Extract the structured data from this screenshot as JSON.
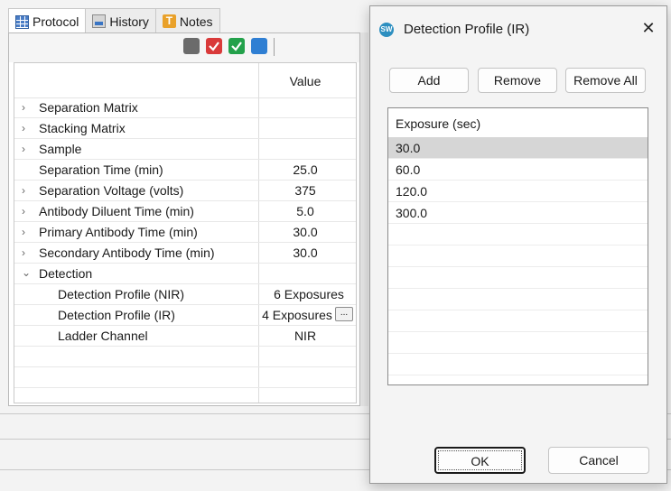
{
  "tabs": [
    {
      "label": "Protocol",
      "icon": "protocol-grid-icon"
    },
    {
      "label": "History",
      "icon": "history-icon"
    },
    {
      "label": "Notes",
      "icon": "notes-icon"
    }
  ],
  "grid": {
    "value_header": "Value",
    "rows": [
      {
        "name": "Separation Matrix",
        "value": ""
      },
      {
        "name": "Stacking Matrix",
        "value": ""
      },
      {
        "name": "Sample",
        "value": ""
      },
      {
        "name": "Separation Time (min)",
        "value": "25.0"
      },
      {
        "name": "Separation Voltage (volts)",
        "value": "375"
      },
      {
        "name": "Antibody Diluent Time (min)",
        "value": "5.0"
      },
      {
        "name": "Primary Antibody Time (min)",
        "value": "30.0"
      },
      {
        "name": "Secondary Antibody Time (min)",
        "value": "30.0"
      },
      {
        "name": "Detection",
        "value": ""
      },
      {
        "name": "Detection Profile (NIR)",
        "value": "6 Exposures"
      },
      {
        "name": "Detection Profile (IR)",
        "value": "4 Exposures",
        "button": "..."
      },
      {
        "name": "Ladder Channel",
        "value": "NIR"
      }
    ]
  },
  "dialog": {
    "title": "Detection Profile (IR)",
    "app_icon_text": "SW",
    "close": "✕",
    "buttons": {
      "add": "Add",
      "remove": "Remove",
      "remove_all": "Remove All",
      "ok": "OK",
      "cancel": "Cancel"
    },
    "list": {
      "header": "Exposure (sec)",
      "items": [
        "30.0",
        "60.0",
        "120.0",
        "300.0"
      ],
      "selected_index": 0
    }
  },
  "colors": {
    "selection": "#d6d6d6",
    "toolbar_red": "#d93a3a",
    "toolbar_green": "#23a14b",
    "toolbar_blue": "#2f7fd3",
    "toolbar_gray": "#6b6b6b"
  }
}
